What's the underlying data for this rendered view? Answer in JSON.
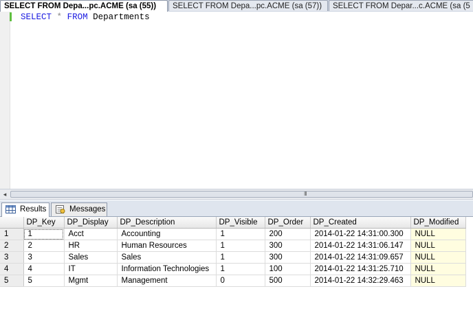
{
  "doc_tabs": [
    {
      "label": "SELECT FROM Depa...pc.ACME (sa (55))",
      "active": true
    },
    {
      "label": "SELECT FROM Depa...pc.ACME (sa (57))",
      "active": false
    },
    {
      "label": "SELECT FROM Depar...c.ACME (sa (5",
      "active": false
    }
  ],
  "editor": {
    "keyword_select": "SELECT",
    "star": "*",
    "keyword_from": "FROM",
    "table_name": "Departments"
  },
  "scrollbar": {
    "left_arrow": "◂",
    "grip": "III"
  },
  "result_tabs": {
    "results_label": "Results",
    "messages_label": "Messages"
  },
  "grid": {
    "columns": [
      "DP_Key",
      "DP_Display",
      "DP_Description",
      "DP_Visible",
      "DP_Order",
      "DP_Created",
      "DP_Modified"
    ],
    "rows": [
      {
        "num": "1",
        "cells": [
          "1",
          "Acct",
          "Accounting",
          "1",
          "200",
          "2014-01-22 14:31:00.300",
          "NULL"
        ]
      },
      {
        "num": "2",
        "cells": [
          "2",
          "HR",
          "Human Resources",
          "1",
          "300",
          "2014-01-22 14:31:06.147",
          "NULL"
        ]
      },
      {
        "num": "3",
        "cells": [
          "3",
          "Sales",
          "Sales",
          "1",
          "300",
          "2014-01-22 14:31:09.657",
          "NULL"
        ]
      },
      {
        "num": "4",
        "cells": [
          "4",
          "IT",
          "Information Technologies",
          "1",
          "100",
          "2014-01-22 14:31:25.710",
          "NULL"
        ]
      },
      {
        "num": "5",
        "cells": [
          "5",
          "Mgmt",
          "Management",
          "0",
          "500",
          "2014-01-22 14:32:29.463",
          "NULL"
        ]
      }
    ]
  },
  "colors": {
    "keyword": "#1a1ae0",
    "change_marker": "#5fbf3f",
    "null_cell": "#fffde0"
  }
}
